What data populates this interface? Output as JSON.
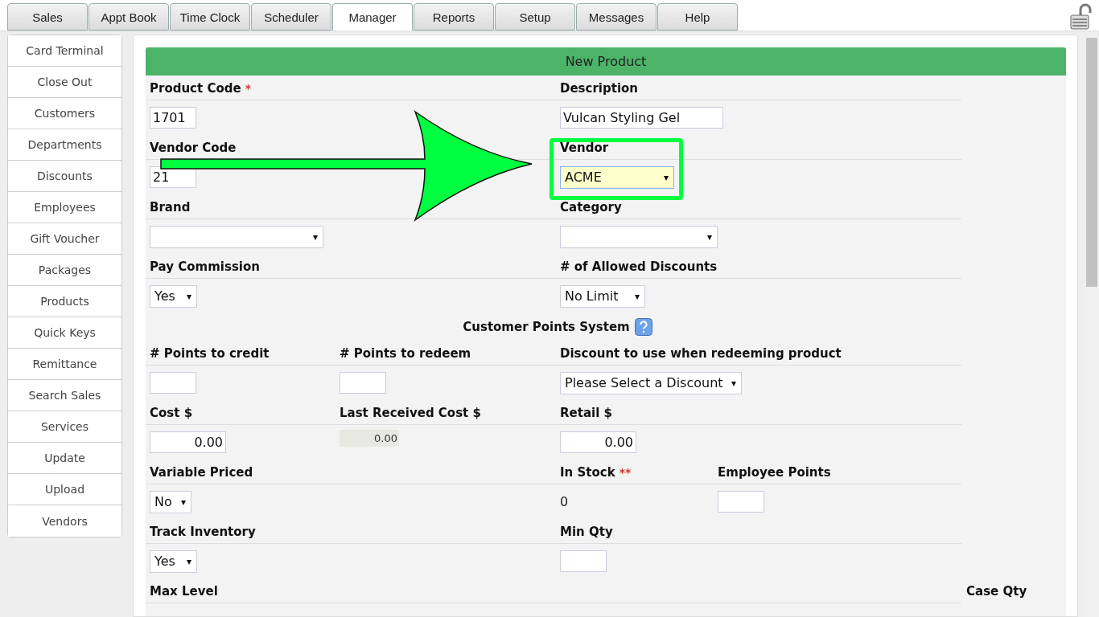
{
  "tabs": [
    {
      "label": "Sales",
      "selected": false
    },
    {
      "label": "Appt Book",
      "selected": false
    },
    {
      "label": "Time Clock",
      "selected": false
    },
    {
      "label": "Scheduler",
      "selected": false
    },
    {
      "label": "Manager",
      "selected": true
    },
    {
      "label": "Reports",
      "selected": false
    },
    {
      "label": "Setup",
      "selected": false
    },
    {
      "label": "Messages",
      "selected": false
    },
    {
      "label": "Help",
      "selected": false
    }
  ],
  "sidebar": {
    "items": [
      "Card Terminal",
      "Close Out",
      "Customers",
      "Departments",
      "Discounts",
      "Employees",
      "Gift Voucher",
      "Packages",
      "Products",
      "Quick Keys",
      "Remittance",
      "Search Sales",
      "Services",
      "Update",
      "Upload",
      "Vendors"
    ]
  },
  "form": {
    "title": "New Product",
    "rows": [
      {
        "kind": "fields",
        "cells": [
          {
            "label": "Product Code",
            "mark": "*",
            "control": {
              "kind": "text",
              "value": "1701"
            }
          },
          null,
          {
            "label": "Description",
            "control": {
              "kind": "wide-text",
              "value": "Vulcan Styling Gel"
            }
          },
          null,
          null
        ]
      },
      {
        "kind": "fields",
        "cells": [
          {
            "label": "Vendor Code",
            "control": {
              "kind": "text",
              "value": "21"
            }
          },
          null,
          {
            "label": "Vendor",
            "highlighted": true,
            "control": {
              "kind": "select",
              "value": "ACME"
            }
          },
          null,
          null
        ]
      },
      {
        "kind": "fields",
        "cells": [
          {
            "label": "Brand",
            "control": {
              "kind": "wide-select"
            }
          },
          null,
          {
            "label": "Category",
            "control": {
              "kind": "wide-select"
            }
          },
          null,
          null
        ]
      },
      {
        "kind": "fields",
        "cells": [
          {
            "label": "Pay Commission",
            "control": {
              "kind": "select",
              "value": "Yes"
            }
          },
          null,
          {
            "label": "# of Allowed Discounts",
            "control": {
              "kind": "select",
              "value": "No Limit"
            }
          },
          null,
          null
        ]
      },
      {
        "kind": "heading",
        "title": "Customer Points System"
      },
      {
        "kind": "fields",
        "cells": [
          {
            "label": "# Points to credit",
            "control": {
              "kind": "text"
            }
          },
          {
            "label": "# Points to redeem",
            "control": {
              "kind": "text"
            }
          },
          {
            "label": "Discount to use when redeeming product",
            "control": {
              "kind": "select",
              "value": "Please Select a Discount"
            }
          },
          null,
          null
        ]
      },
      {
        "kind": "fields",
        "cells": [
          {
            "label": "Cost $",
            "control": {
              "kind": "number",
              "value": "0.00"
            }
          },
          {
            "label": "Last Received Cost $",
            "control": {
              "kind": "readonly",
              "value": "0.00"
            }
          },
          {
            "label": "Retail $",
            "control": {
              "kind": "number",
              "value": "0.00"
            }
          },
          null,
          null
        ]
      },
      {
        "kind": "fields",
        "cells": [
          {
            "label": "Variable Priced",
            "control": {
              "kind": "select",
              "value": "No"
            }
          },
          null,
          {
            "label": "In Stock",
            "mark": "**",
            "control": {
              "kind": "plain",
              "value": "0"
            }
          },
          {
            "label": "Employee Points",
            "control": {
              "kind": "text"
            }
          },
          null
        ]
      },
      {
        "kind": "fields",
        "cells": [
          {
            "label": "Track Inventory",
            "control": {
              "kind": "select",
              "value": "Yes"
            }
          },
          null,
          {
            "label": "Min Qty",
            "control": {
              "kind": "text"
            }
          },
          null,
          null
        ]
      },
      {
        "kind": "fields",
        "cells": [
          {
            "label": "Max Level"
          },
          null,
          null,
          null,
          {
            "label": "Case Qty"
          }
        ]
      }
    ]
  }
}
